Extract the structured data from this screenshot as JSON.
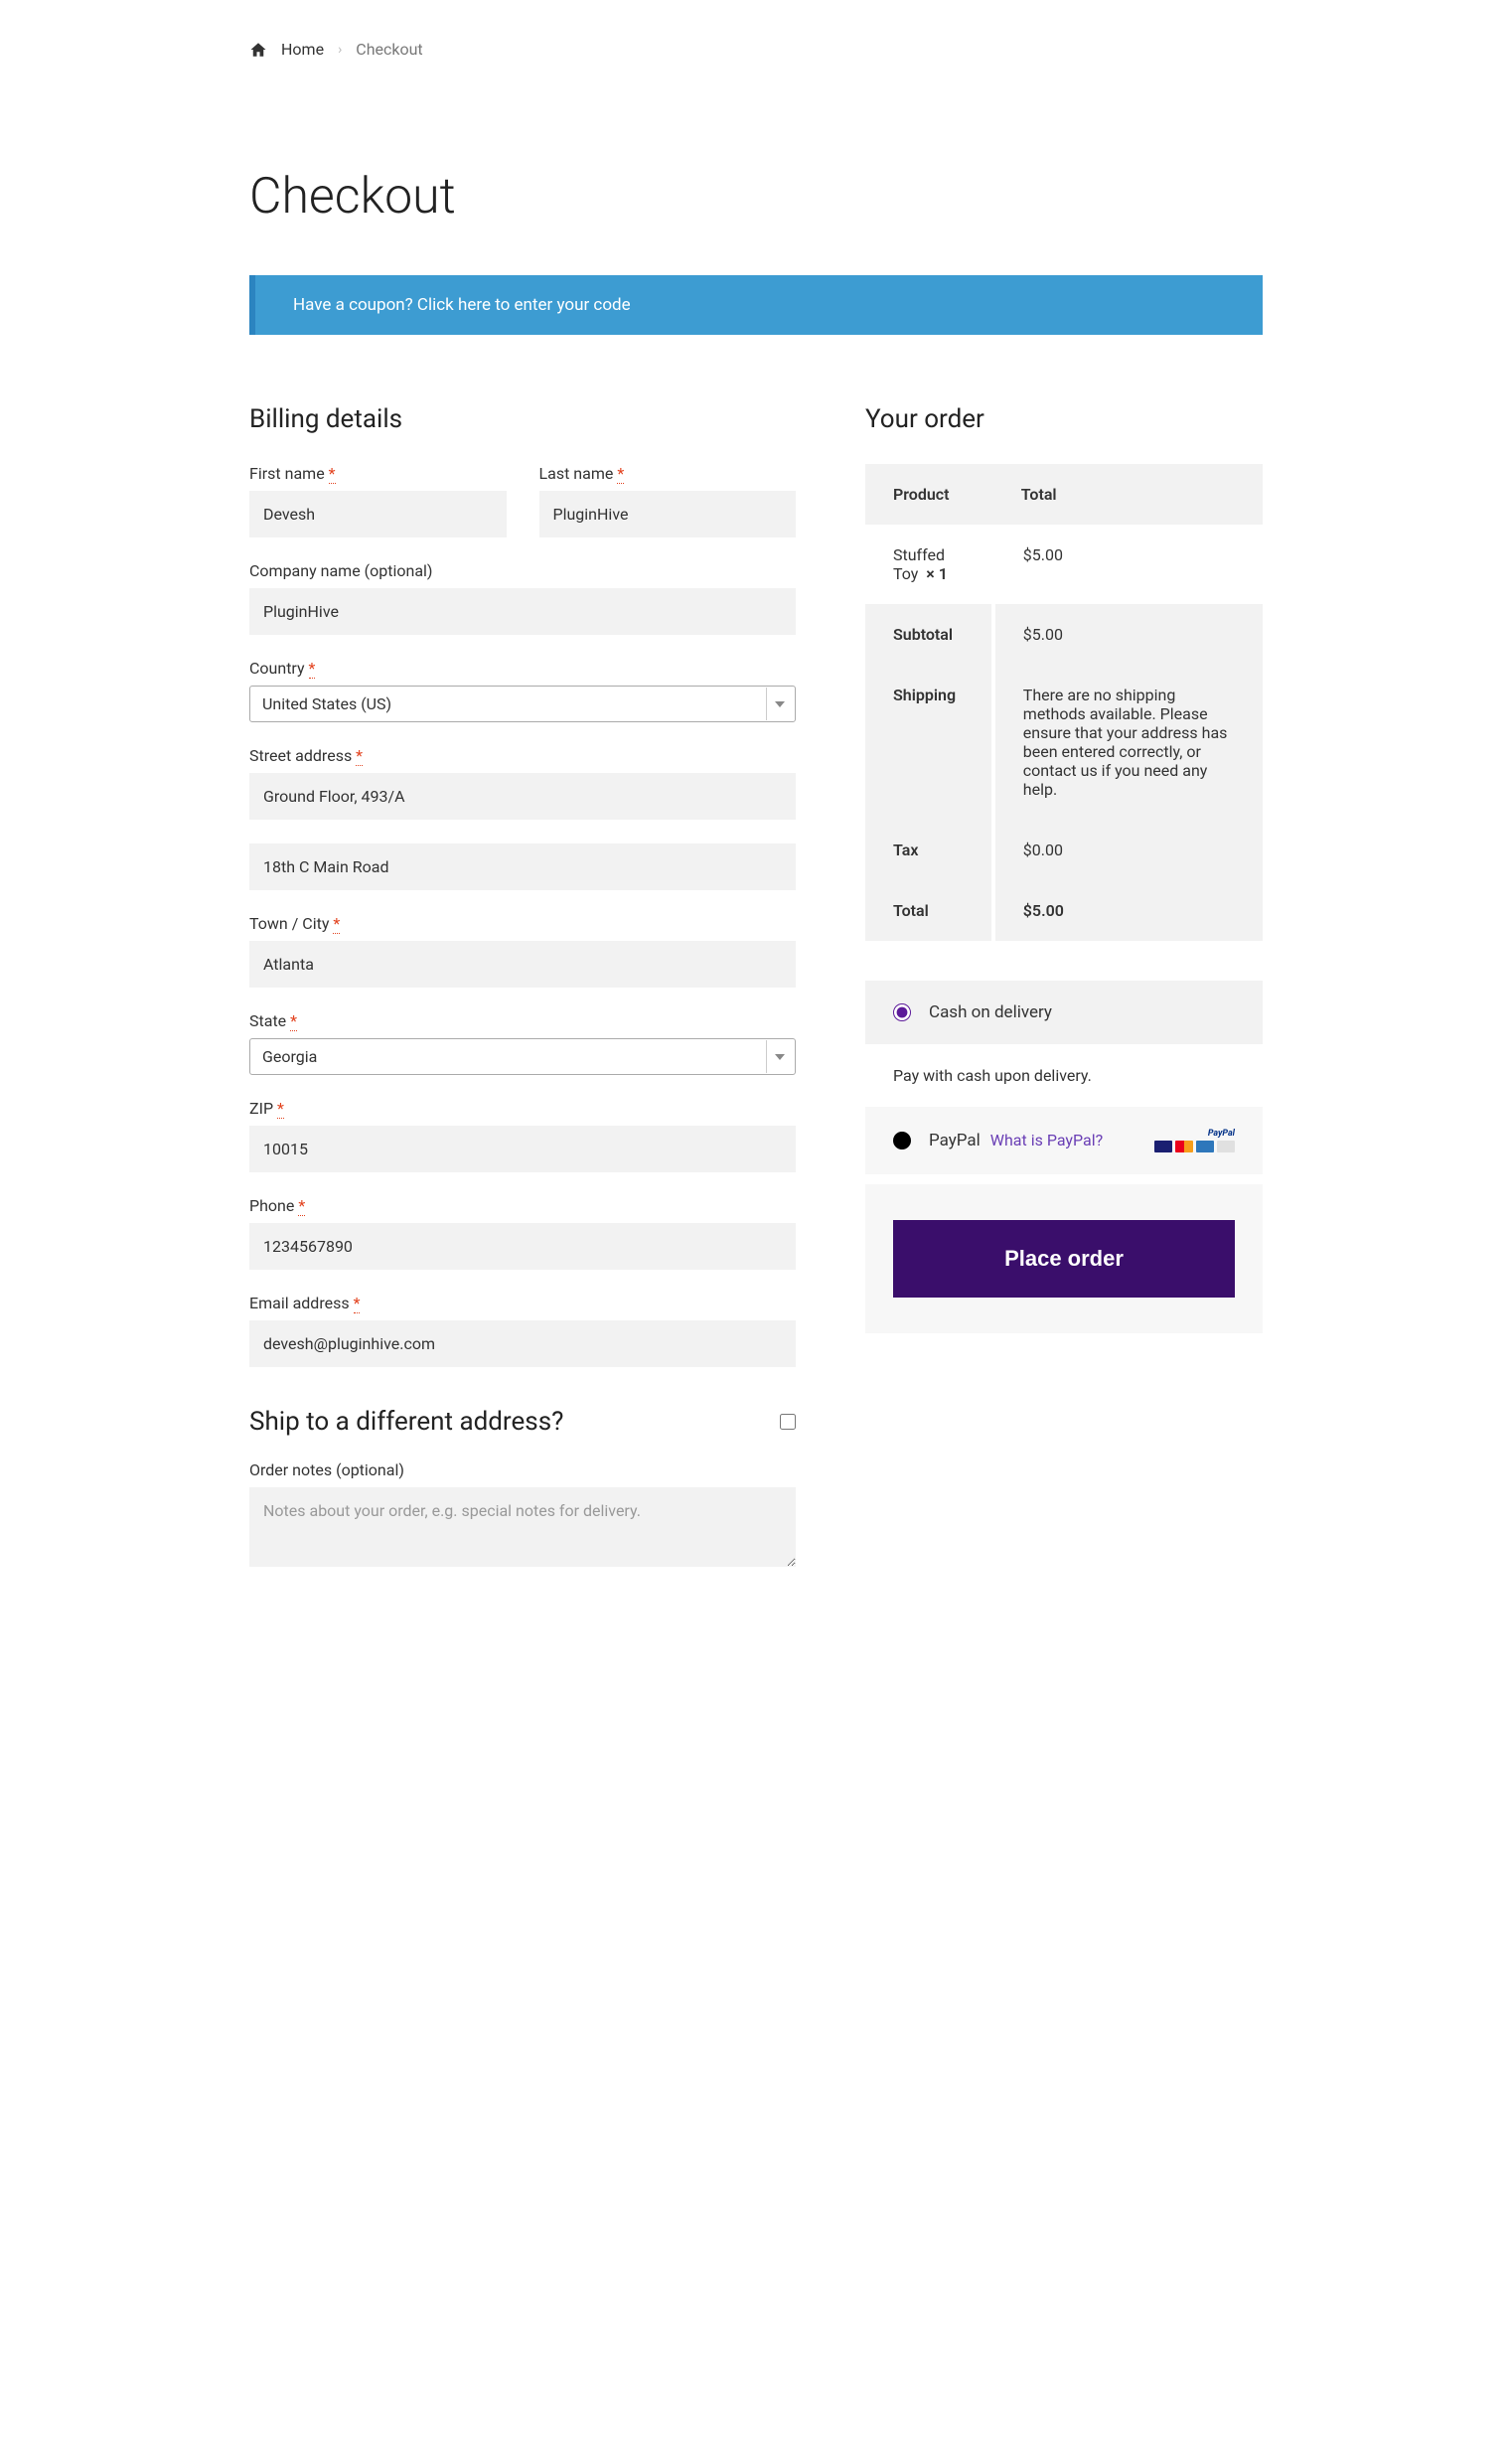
{
  "breadcrumb": {
    "home": "Home",
    "current": "Checkout"
  },
  "page_title": "Checkout",
  "coupon_banner": "Have a coupon? Click here to enter your code",
  "billing": {
    "heading": "Billing details",
    "first_name": {
      "label": "First name",
      "value": "Devesh"
    },
    "last_name": {
      "label": "Last name",
      "value": "PluginHive"
    },
    "company": {
      "label": "Company name (optional)",
      "value": "PluginHive"
    },
    "country": {
      "label": "Country",
      "value": "United States (US)"
    },
    "street": {
      "label": "Street address",
      "line1": "Ground Floor, 493/A",
      "line2": "18th C Main Road"
    },
    "city": {
      "label": "Town / City",
      "value": "Atlanta"
    },
    "state": {
      "label": "State",
      "value": "Georgia"
    },
    "zip": {
      "label": "ZIP",
      "value": "10015"
    },
    "phone": {
      "label": "Phone",
      "value": "1234567890"
    },
    "email": {
      "label": "Email address",
      "value": "devesh@pluginhive.com"
    }
  },
  "ship_diff": {
    "heading": "Ship to a different address?",
    "checked": false
  },
  "order_notes": {
    "label": "Order notes (optional)",
    "placeholder": "Notes about your order, e.g. special notes for delivery.",
    "value": ""
  },
  "order": {
    "heading": "Your order",
    "columns": {
      "product": "Product",
      "total": "Total"
    },
    "items": [
      {
        "name": "Stuffed Toy",
        "qty": "× 1",
        "total": "$5.00"
      }
    ],
    "subtotal": {
      "label": "Subtotal",
      "value": "$5.00"
    },
    "shipping": {
      "label": "Shipping",
      "value": "There are no shipping methods available. Please ensure that your address has been entered correctly, or contact us if you need any help."
    },
    "tax": {
      "label": "Tax",
      "value": "$0.00"
    },
    "total": {
      "label": "Total",
      "value": "$5.00"
    }
  },
  "payment": {
    "cod": {
      "label": "Cash on delivery",
      "desc": "Pay with cash upon delivery.",
      "selected": true
    },
    "paypal": {
      "label": "PayPal",
      "whatis": "What is PayPal?",
      "selected": false
    }
  },
  "place_order": "Place order"
}
